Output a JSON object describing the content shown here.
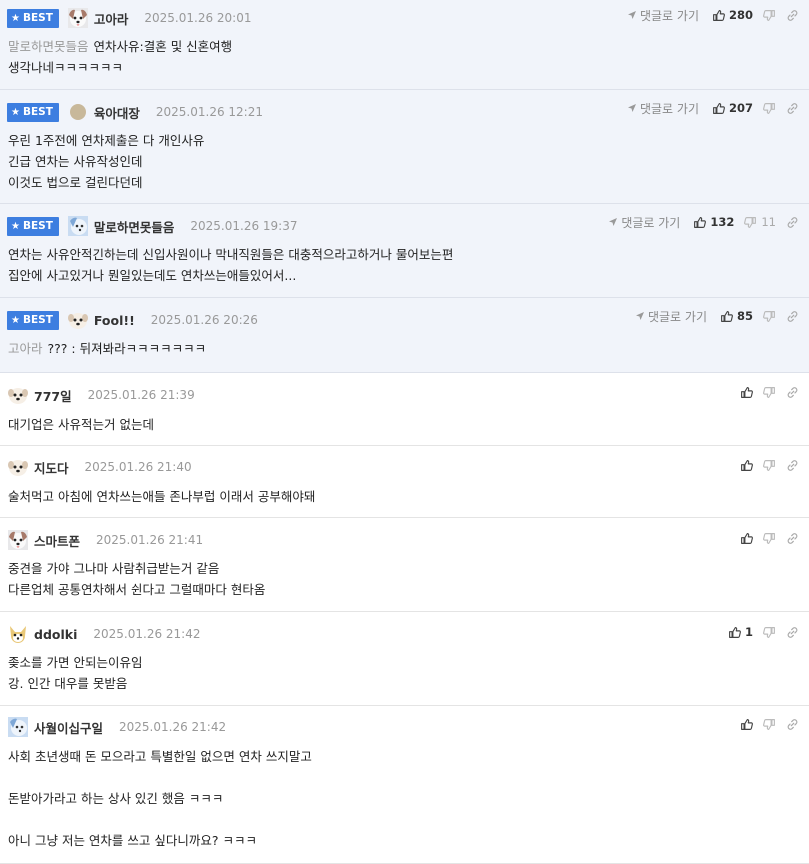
{
  "colors": {
    "best_bg": "#f1f4fa",
    "badge": "#3d7ee0",
    "date": "#999999",
    "quote": "#999999"
  },
  "reply_label": "댓글로 가기",
  "best_label": "BEST",
  "comments": [
    {
      "best": true,
      "avatar": "dog-white",
      "nick": "고아라",
      "date": "2025.01.26 20:01",
      "show_reply": true,
      "likes": "280",
      "dislikes": "",
      "quote": "말로하면못들음",
      "lines": [
        "연차사유:결혼 및 신혼여행",
        "생각나네ㅋㅋㅋㅋㅋㅋ"
      ]
    },
    {
      "best": true,
      "avatar": "dot",
      "nick": "육아대장",
      "date": "2025.01.26 12:21",
      "show_reply": true,
      "likes": "207",
      "dislikes": "",
      "quote": "",
      "lines": [
        "우린 1주전에 연차제출은 다 개인사유",
        "긴급 연차는 사유작성인데",
        "이것도 법으로 걸린다던데"
      ]
    },
    {
      "best": true,
      "avatar": "dog-blue",
      "nick": "말로하면못들음",
      "date": "2025.01.26 19:37",
      "show_reply": true,
      "likes": "132",
      "dislikes": "11",
      "quote": "",
      "lines": [
        "연차는 사유안적긴하는데 신입사원이나 막내직원들은 대충적으라고하거나 물어보는편",
        "집안에 사고있거나 뭔일있는데도 연차쓰는애들있어서..."
      ]
    },
    {
      "best": true,
      "avatar": "dog-face",
      "nick": "Fool!!",
      "date": "2025.01.26 20:26",
      "show_reply": true,
      "likes": "85",
      "dislikes": "",
      "quote": "고아라",
      "lines": [
        "??? : 뒤져봐라ㅋㅋㅋㅋㅋㅋㅋ"
      ]
    },
    {
      "best": false,
      "avatar": "dog-face",
      "nick": "777일",
      "date": "2025.01.26 21:39",
      "show_reply": false,
      "likes": "",
      "dislikes": "",
      "quote": "",
      "lines": [
        "대기업은 사유적는거 없는데"
      ]
    },
    {
      "best": false,
      "avatar": "dog-face",
      "nick": "지도다",
      "date": "2025.01.26 21:40",
      "show_reply": false,
      "likes": "",
      "dislikes": "",
      "quote": "",
      "lines": [
        "술처먹고 아침에 연차쓰는애들 존나부럽 이래서 공부해야돼"
      ]
    },
    {
      "best": false,
      "avatar": "dog-white",
      "nick": "스마트폰",
      "date": "2025.01.26 21:41",
      "show_reply": false,
      "likes": "",
      "dislikes": "",
      "quote": "",
      "lines": [
        "중견을 가야 그나마 사람취급받는거 같음",
        "다른업체 공통연차해서 쉰다고 그럴때마다 현타옴"
      ]
    },
    {
      "best": false,
      "avatar": "dog-yellow",
      "nick": "ddolki",
      "date": "2025.01.26 21:42",
      "show_reply": false,
      "likes": "1",
      "dislikes": "",
      "quote": "",
      "lines": [
        "좆소를 가면 안되는이유임",
        "강. 인간 대우를 못받음"
      ]
    },
    {
      "best": false,
      "avatar": "dog-blue",
      "nick": "사월이십구일",
      "date": "2025.01.26 21:42",
      "show_reply": false,
      "likes": "",
      "dislikes": "",
      "quote": "",
      "lines": [
        "사회 초년생때 돈 모으라고 특별한일 없으면 연차 쓰지말고",
        "",
        "돈받아가라고 하는 상사 있긴 했음 ㅋㅋㅋ",
        "",
        "아니 그냥 저는 연차를 쓰고 싶다니까요? ㅋㅋㅋ"
      ]
    }
  ]
}
